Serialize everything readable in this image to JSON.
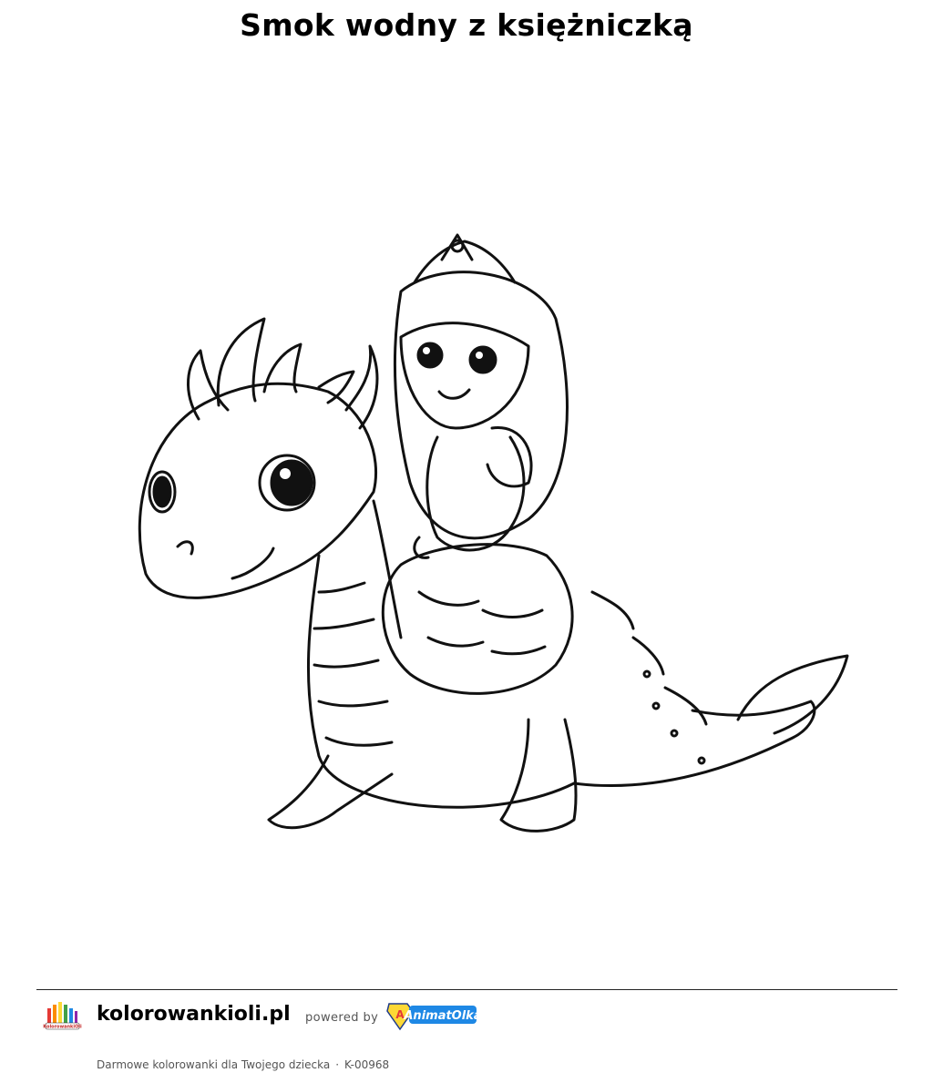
{
  "page": {
    "title": "Smok wodny z księżniczką"
  },
  "artwork": {
    "subject_icon": "dragon-princess-line-art"
  },
  "footer": {
    "site_name": "kolorowankioli.pl",
    "powered_by": "powered by",
    "partner_logo_text": "AnimatOlka",
    "tagline": "Darmowe kolorowanki dla Twojego dziecka",
    "separator": "·",
    "code": "K-00968",
    "site_logo_text": "KolorowankiOli"
  },
  "colors": {
    "line": "#111111",
    "partner_blue": "#1e88e5",
    "partner_red": "#e53935",
    "partner_yellow": "#fdd835"
  }
}
